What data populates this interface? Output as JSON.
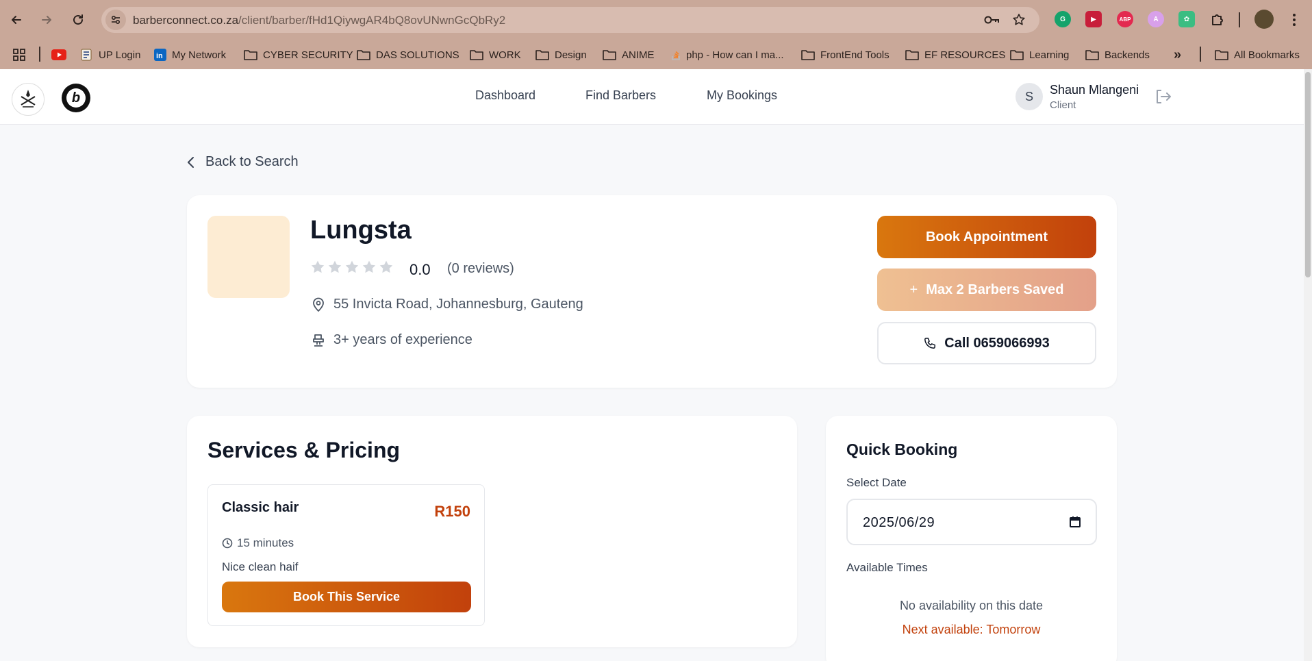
{
  "browser": {
    "url_host": "barberconnect.co.za",
    "url_path": "/client/barber/fHd1QiywgAR4bQ8ovUNwnGcQbRy2",
    "bookmarks": [
      {
        "label": "UP Login"
      },
      {
        "label": "My Network"
      },
      {
        "label": "CYBER SECURITY"
      },
      {
        "label": "DAS SOLUTIONS"
      },
      {
        "label": "WORK"
      },
      {
        "label": "Design"
      },
      {
        "label": "ANIME"
      },
      {
        "label": "php - How can I ma..."
      },
      {
        "label": "FrontEnd Tools"
      },
      {
        "label": "EF RESOURCES"
      },
      {
        "label": "Learning"
      },
      {
        "label": "Backends"
      }
    ],
    "overflow_label": "»",
    "all_bookmarks": "All Bookmarks",
    "extensions": [
      "grammarly-icon",
      "video-ext-icon",
      "adblock-plus-icon",
      "angular-ext-icon",
      "chatgpt-ext-icon",
      "extensions-puzzle-icon"
    ],
    "abp_text": "ABP"
  },
  "header": {
    "nav": [
      "Dashboard",
      "Find Barbers",
      "My Bookings"
    ],
    "user_initial": "S",
    "user_name": "Shaun Mlangeni",
    "user_role": "Client"
  },
  "back_label": "Back to Search",
  "barber": {
    "name": "Lungsta",
    "rating": "0.0",
    "reviews": "(0 reviews)",
    "stars_filled": 0,
    "stars_total": 5,
    "address": "55 Invicta Road, Johannesburg, Gauteng",
    "experience": "3+ years of experience"
  },
  "actions": {
    "book": "Book Appointment",
    "max_saved": "Max 2 Barbers Saved",
    "max_saved_prefix": "+",
    "call": "Call 0659066993"
  },
  "services": {
    "title": "Services & Pricing",
    "items": [
      {
        "name": "Classic hair",
        "price": "R150",
        "duration": "15 minutes",
        "description": "Nice clean haif",
        "button": "Book This Service"
      }
    ]
  },
  "quick_booking": {
    "title": "Quick Booking",
    "date_label": "Select Date",
    "date_value": "2025/06/29",
    "times_label": "Available Times",
    "no_availability": "No availability on this date",
    "next_available": "Next available: Tomorrow"
  },
  "colors": {
    "accent_start": "#d9770e",
    "accent_end": "#c2410c",
    "chrome": "#c9a899"
  }
}
